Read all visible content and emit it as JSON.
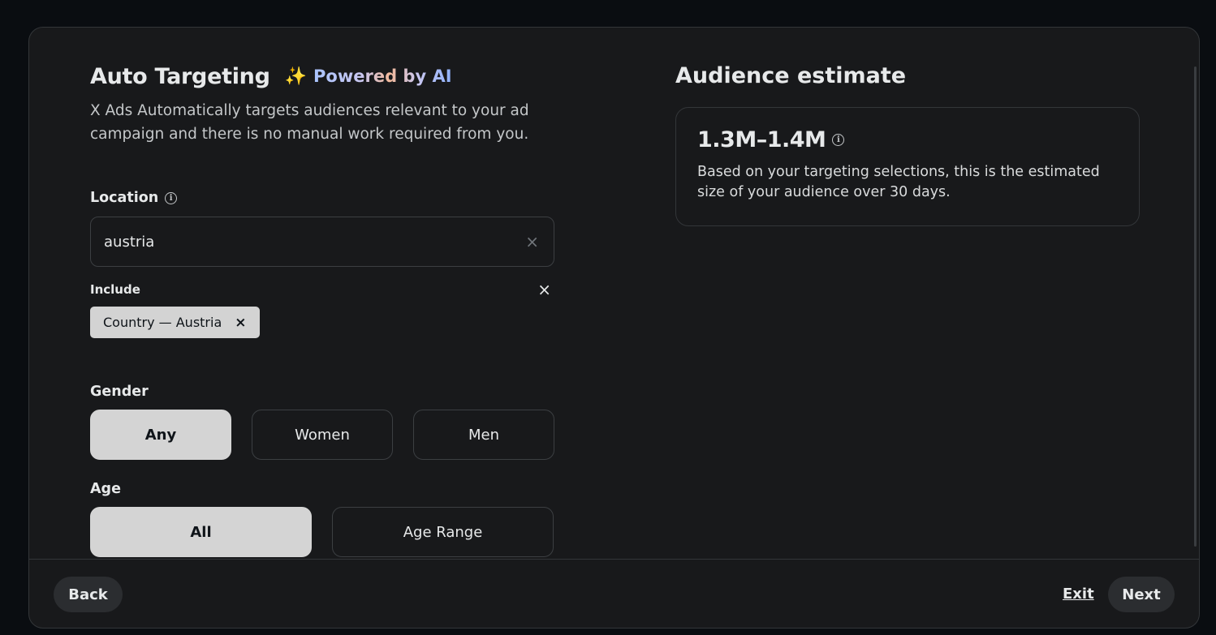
{
  "auto_targeting": {
    "title": "Auto Targeting",
    "sparkle_icon": "sparkle-icon",
    "ai_badge": "Powered by AI",
    "subtitle": "X Ads Automatically targets audiences relevant to your ad campaign and there is no manual work required from you."
  },
  "location": {
    "label": "Location",
    "input_value": "austria",
    "clear_icon": "×",
    "include_label": "Include",
    "include_close_icon": "×",
    "chips": [
      {
        "label": "Country — Austria",
        "remove_icon": "×"
      }
    ]
  },
  "gender": {
    "label": "Gender",
    "options": [
      "Any",
      "Women",
      "Men"
    ],
    "selected": "Any"
  },
  "age": {
    "label": "Age",
    "options": [
      "All",
      "Age Range"
    ],
    "selected": "All"
  },
  "audience": {
    "title": "Audience estimate",
    "value": "1.3M–1.4M",
    "description": "Based on your targeting selections, this is the estimated size of your audience over 30 days."
  },
  "footer": {
    "back_label": "Back",
    "exit_label": "Exit",
    "next_label": "Next"
  }
}
